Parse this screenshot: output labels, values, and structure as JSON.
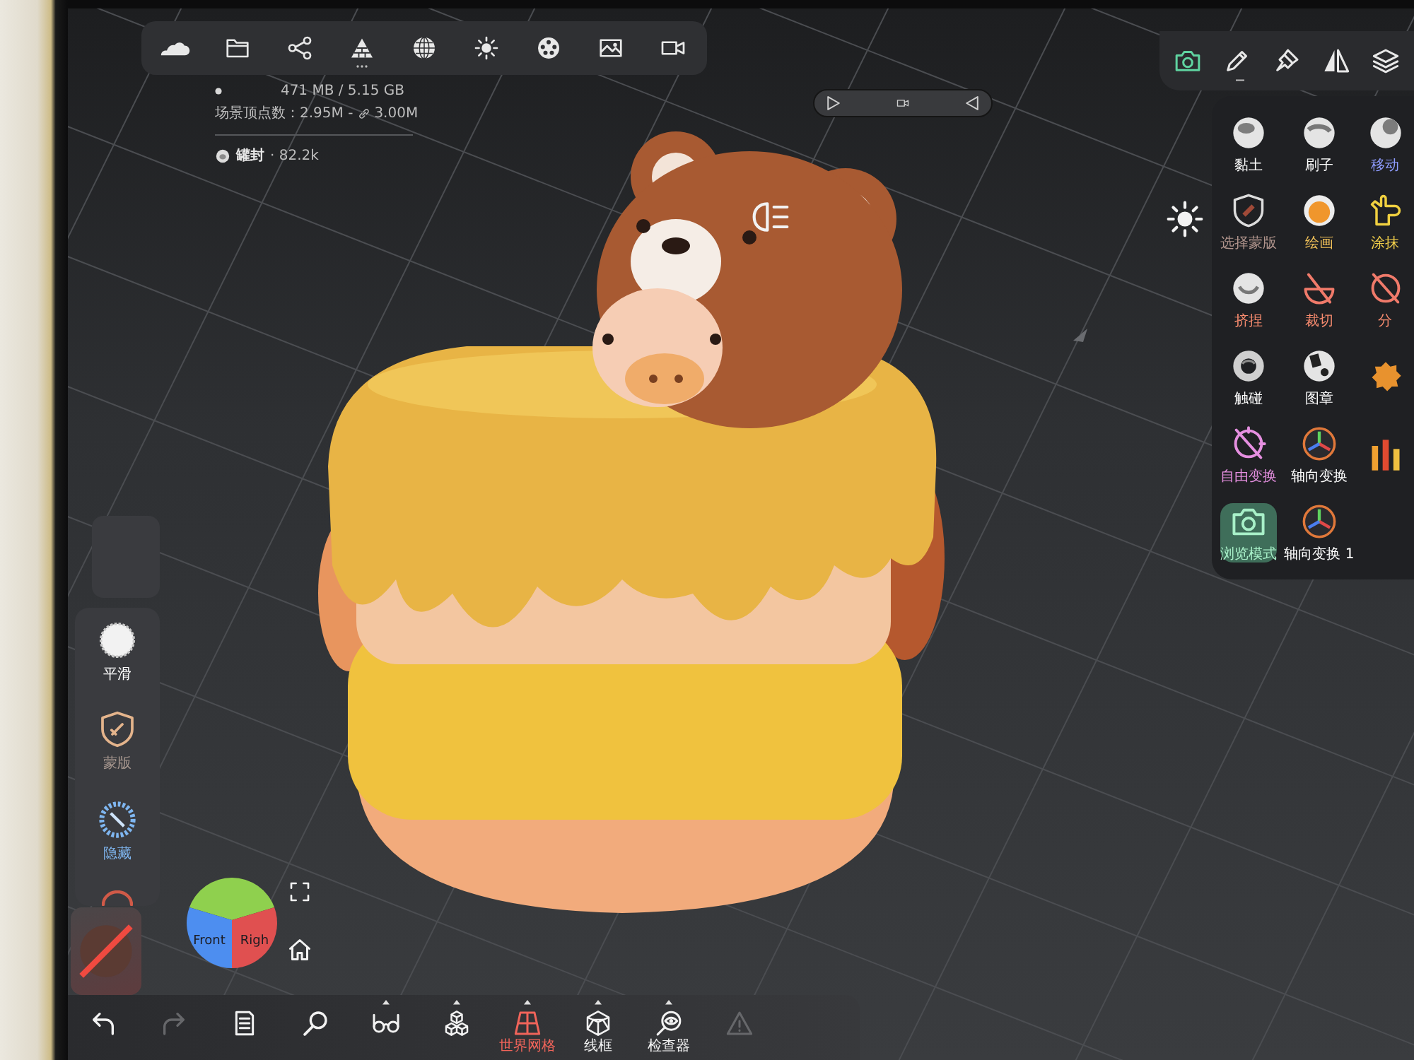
{
  "top_toolbar": {
    "items": [
      {
        "kind": "cloud",
        "has_menu": false
      },
      {
        "kind": "folder",
        "has_menu": false
      },
      {
        "kind": "share",
        "has_menu": false
      },
      {
        "kind": "pile",
        "has_menu": true
      },
      {
        "kind": "globe",
        "has_menu": false
      },
      {
        "kind": "sun",
        "has_menu": false
      },
      {
        "kind": "texture",
        "has_menu": false
      },
      {
        "kind": "image",
        "has_menu": false
      },
      {
        "kind": "video",
        "has_menu": false
      }
    ]
  },
  "stats": {
    "memory": "471 MB / 5.15 GB",
    "vertices": "场景顶点数：2.95M -",
    "vertices_multires": "3.00M",
    "object_name": "罐封",
    "object_vertices": "· 82.2k"
  },
  "camera_bar": {
    "items": [
      {
        "kind": "next"
      },
      {
        "kind": "video"
      },
      {
        "kind": "prev"
      }
    ]
  },
  "tool_tabs": [
    {
      "kind": "camera",
      "selected": true,
      "has_menu": false
    },
    {
      "kind": "pen",
      "selected": false,
      "has_menu": true
    },
    {
      "kind": "brush",
      "selected": false,
      "has_menu": false
    },
    {
      "kind": "mirror",
      "selected": false,
      "has_menu": false
    },
    {
      "kind": "layers",
      "selected": false,
      "has_menu": false
    }
  ],
  "tools": [
    {
      "kind": "clay",
      "label": "黏土",
      "color": "#ffffff",
      "selected": false
    },
    {
      "kind": "groove",
      "label": "刷子",
      "color": "#ffffff",
      "selected": false
    },
    {
      "kind": "move",
      "label": "移动",
      "color": "#8f9cff",
      "selected": false
    },
    {
      "kind": "select_mask",
      "label": "选择蒙版",
      "color": "#b0948c",
      "selected": false
    },
    {
      "kind": "paint",
      "label": "绘画",
      "color": "#f2c25a",
      "selected": false
    },
    {
      "kind": "smudge",
      "label": "涂抹",
      "color": "#f2cf4a",
      "selected": false
    },
    {
      "kind": "pinch",
      "label": "挤捏",
      "color": "#f58a6e",
      "selected": false
    },
    {
      "kind": "trim",
      "label": "裁切",
      "color": "#f58a6e",
      "selected": false
    },
    {
      "kind": "split",
      "label": "分",
      "color": "#f58a6e",
      "selected": false
    },
    {
      "kind": "crease",
      "label": "触碰",
      "color": "#ffffff",
      "selected": false
    },
    {
      "kind": "stamp",
      "label": "图章",
      "color": "#ffffff",
      "selected": false
    },
    {
      "kind": "blob",
      "selected": false
    },
    {
      "kind": "free_transform",
      "label": "自由变换",
      "color": "#e58fe0",
      "selected": false
    },
    {
      "kind": "axis",
      "label": "轴向变换",
      "color": "#ffffff",
      "selected": false
    },
    {
      "kind": "bars",
      "selected": false
    },
    {
      "kind": "camera",
      "label": "浏览模式",
      "color": "#a8f0c8",
      "selected": true
    },
    {
      "kind": "axis",
      "label": "轴向变换 1",
      "color": "#ffffff",
      "selected": false
    }
  ],
  "left_tools": [
    {
      "kind": "smooth",
      "label": "平滑",
      "color": "#ffffff"
    },
    {
      "kind": "mask",
      "label": "蒙版",
      "color": "#a89890"
    },
    {
      "kind": "hide",
      "label": "隐藏",
      "color": "#7fb6f0"
    },
    {
      "kind": "ring"
    }
  ],
  "nav_cube": {
    "faces": [
      {
        "kind": "top",
        "color": "#8fd04e"
      },
      {
        "kind": "front",
        "label": "Front",
        "color": "#4d8ef0"
      },
      {
        "kind": "right",
        "label": "Righ",
        "color": "#e05050"
      }
    ]
  },
  "bottom_toolbar": [
    {
      "kind": "undo",
      "selected": false,
      "disabled": false,
      "has_menu": false
    },
    {
      "kind": "redo",
      "selected": false,
      "disabled": true,
      "has_menu": false
    },
    {
      "kind": "file",
      "selected": false,
      "disabled": false,
      "has_menu": false
    },
    {
      "kind": "search",
      "selected": false,
      "disabled": false,
      "has_menu": false
    },
    {
      "kind": "glasses",
      "selected": false,
      "disabled": false,
      "has_menu": true
    },
    {
      "kind": "cubes",
      "selected": false,
      "disabled": false,
      "has_menu": true
    },
    {
      "kind": "grid",
      "label": "世界网格",
      "selected": true,
      "disabled": false,
      "has_menu": true
    },
    {
      "kind": "wireframe",
      "label": "线框",
      "selected": false,
      "disabled": false,
      "has_menu": true
    },
    {
      "kind": "inspector",
      "label": "检查器",
      "selected": false,
      "disabled": false,
      "has_menu": true
    },
    {
      "kind": "warning",
      "selected": false,
      "disabled": true,
      "has_menu": false
    }
  ]
}
